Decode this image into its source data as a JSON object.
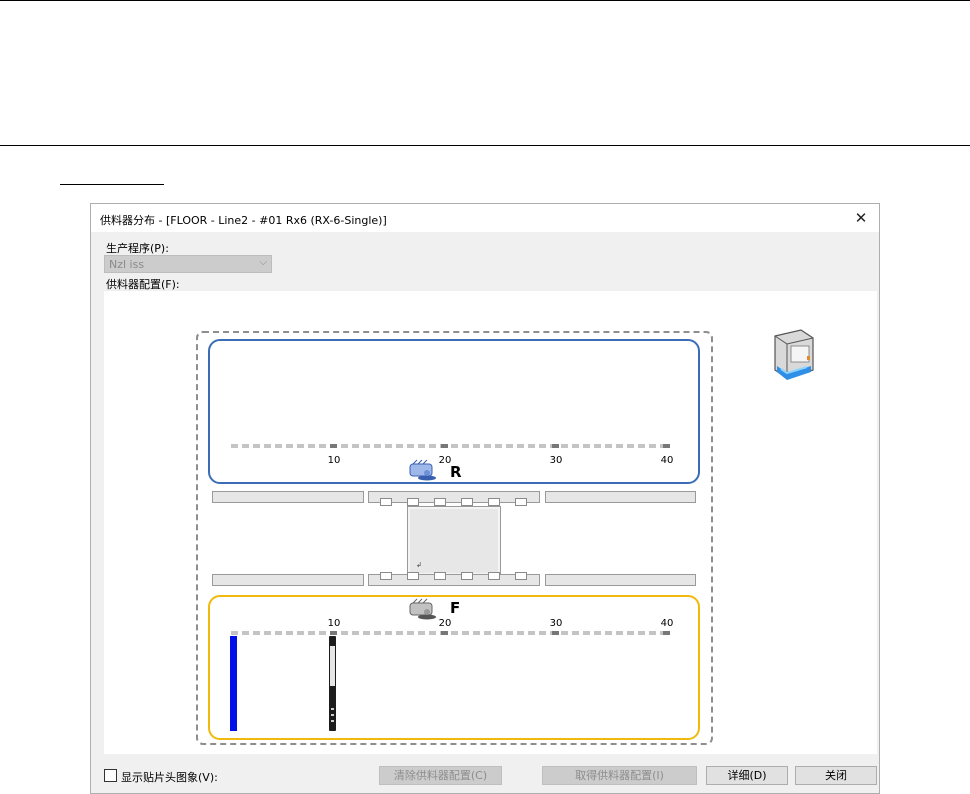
{
  "dialog": {
    "title": "供料器分布 - [FLOOR - Line2 - #01 Rx6 (RX-6-Single)]",
    "close_symbol": "✕"
  },
  "program": {
    "label": "生产程序(P):",
    "value": "Nzl iss",
    "arrow": "⌵"
  },
  "feeder_layout": {
    "label": "供料器配置(F):"
  },
  "zone_rear": {
    "letter": "R",
    "scale": [
      "10",
      "20",
      "30",
      "40"
    ],
    "color": "#3a6db5"
  },
  "zone_front": {
    "letter": "F",
    "scale": [
      "10",
      "20",
      "30",
      "40"
    ],
    "color": "#f0b90b"
  },
  "board_mark": "↲",
  "footer": {
    "show_nozzle_label": "显示贴片头图象(V):",
    "show_nozzle_checked": false,
    "clear_button": "清除供料器配置(C)",
    "get_button": "取得供料器配置(I)",
    "detail_button": "详细(D)",
    "close_button": "关闭"
  },
  "icons": {
    "rear_head": "placement-head-icon",
    "front_head": "placement-head-icon",
    "machine": "machine-icon"
  }
}
